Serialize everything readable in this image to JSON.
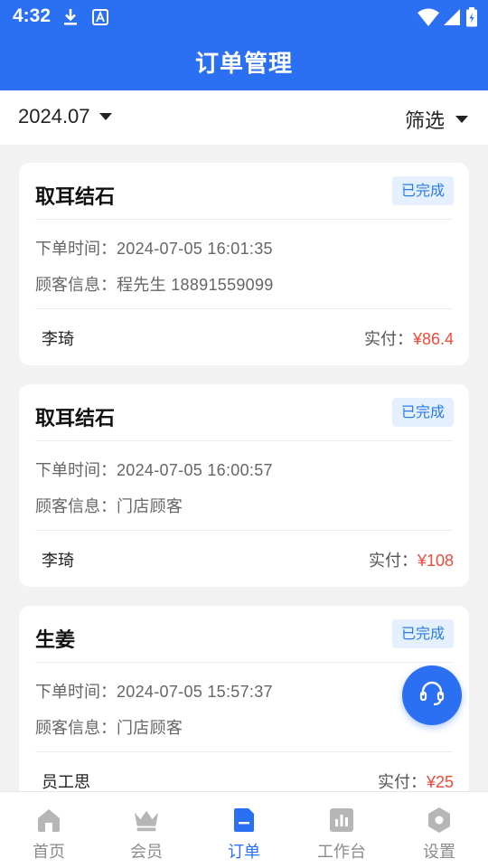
{
  "status_bar": {
    "time": "4:32",
    "left_icons": [
      "download-icon",
      "app-a-icon"
    ],
    "right_icons": [
      "wifi-icon",
      "signal-icon",
      "battery-icon"
    ]
  },
  "header": {
    "title": "订单管理"
  },
  "filters": {
    "month": "2024.07",
    "filter_label": "筛选"
  },
  "orders": [
    {
      "name": "取耳结石",
      "status": "已完成",
      "order_time_label": "下单时间：",
      "order_time": "2024-07-05 16:01:35",
      "customer_label": "顾客信息：",
      "customer": "程先生 18891559099",
      "staff": "李琦",
      "paid_label": "实付：",
      "paid": "¥86.4"
    },
    {
      "name": "取耳结石",
      "status": "已完成",
      "order_time_label": "下单时间：",
      "order_time": "2024-07-05 16:00:57",
      "customer_label": "顾客信息：",
      "customer": "门店顾客",
      "staff": "李琦",
      "paid_label": "实付：",
      "paid": "¥108"
    },
    {
      "name": "生姜",
      "status": "已完成",
      "order_time_label": "下单时间：",
      "order_time": "2024-07-05 15:57:37",
      "customer_label": "顾客信息：",
      "customer": "门店顾客",
      "staff": "员工思",
      "paid_label": "实付：",
      "paid": "¥25"
    }
  ],
  "fab": {
    "icon": "headset-icon"
  },
  "bottom_nav": [
    {
      "label": "首页",
      "icon": "home-icon",
      "active": false
    },
    {
      "label": "会员",
      "icon": "crown-icon",
      "active": false
    },
    {
      "label": "订单",
      "icon": "order-icon",
      "active": true
    },
    {
      "label": "工作台",
      "icon": "chart-icon",
      "active": false
    },
    {
      "label": "设置",
      "icon": "settings-icon",
      "active": false
    }
  ],
  "colors": {
    "primary": "#2b6ff3",
    "badge_bg": "#e4f0fd",
    "badge_text": "#2b7be6",
    "price": "#f04a3a",
    "nav_inactive": "#8c8c8c",
    "page_bg": "#f2f2f2"
  }
}
